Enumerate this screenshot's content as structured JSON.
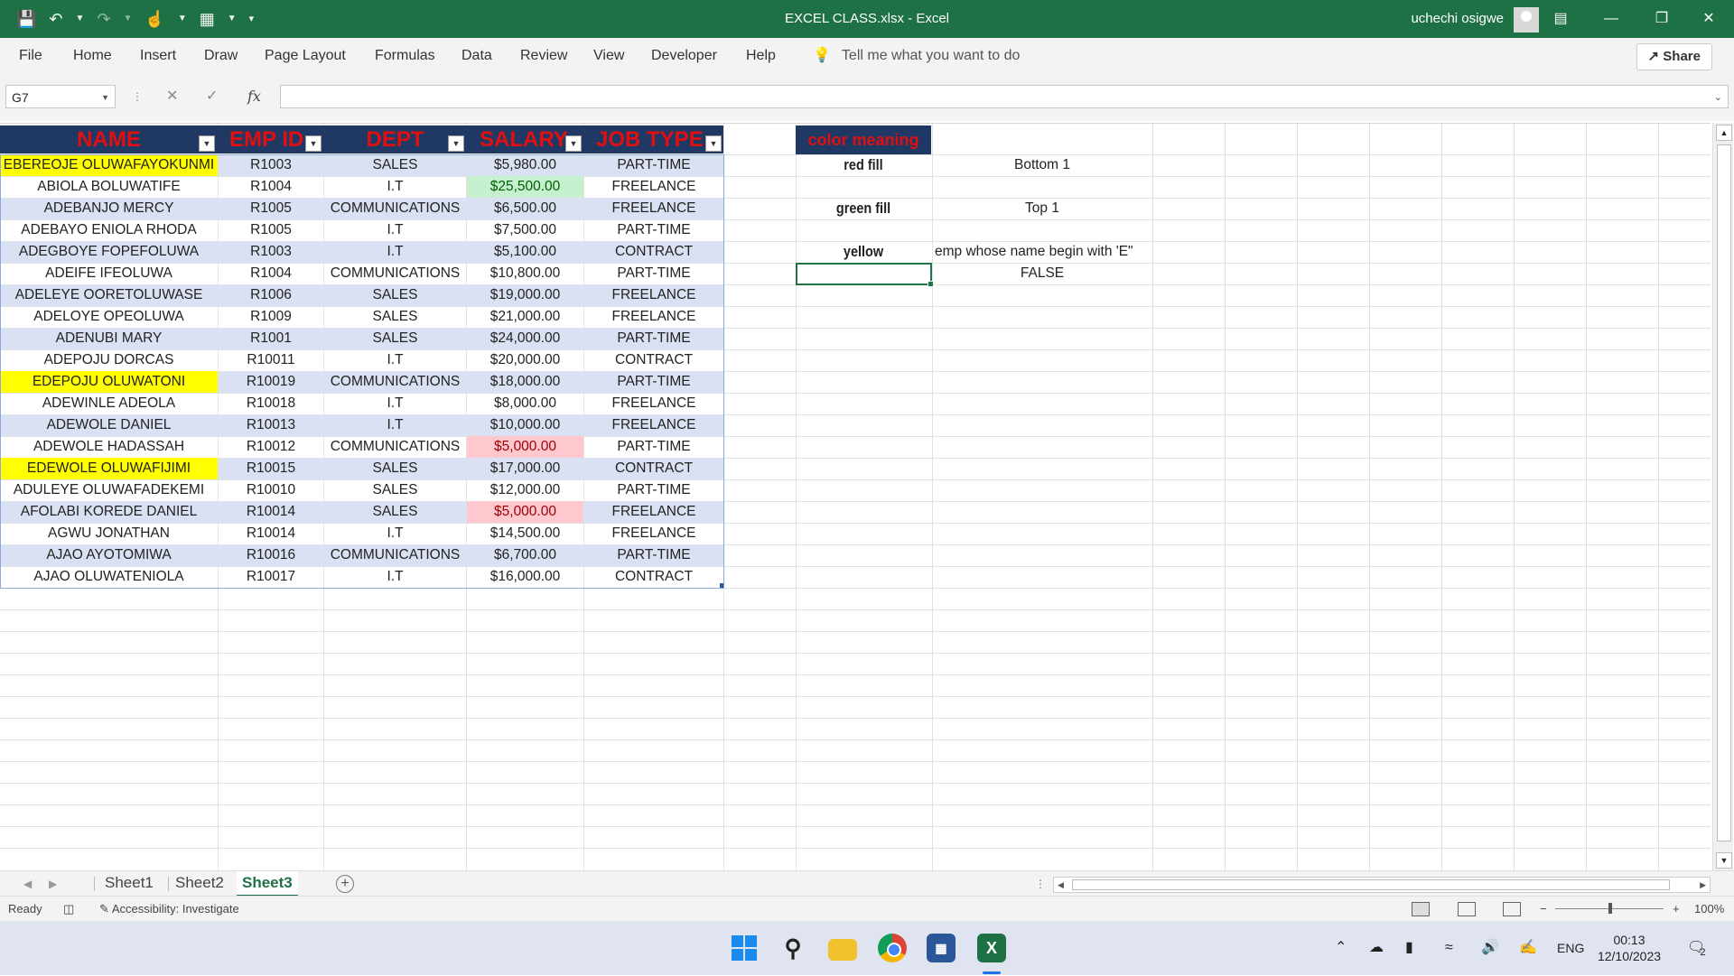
{
  "titlebar": {
    "title": "EXCEL CLASS.xlsx  -  Excel",
    "user": "uchechi osigwe",
    "qat": [
      "save-icon",
      "undo-icon",
      "redo-icon",
      "touch-mode-icon",
      "form-icon",
      "customize-qat-icon"
    ]
  },
  "ribbon": {
    "tabs": [
      "File",
      "Home",
      "Insert",
      "Draw",
      "Page Layout",
      "Formulas",
      "Data",
      "Review",
      "View",
      "Developer",
      "Help"
    ],
    "tell_me": "Tell me what you want to do",
    "share": "Share"
  },
  "formula_bar": {
    "name_box": "G7",
    "cancel": "✕",
    "enter": "✓",
    "fx": "fx",
    "value": ""
  },
  "table": {
    "headers": [
      "NAME",
      "EMP ID",
      "DEPT",
      "SALARY",
      "JOB TYPE"
    ],
    "rows": [
      {
        "name": "EBEREOJE OLUWAFAYOKUNMI",
        "id": "R1003",
        "dept": "SALES",
        "salary": "$5,980.00",
        "job": "PART-TIME",
        "name_fill": "yellow"
      },
      {
        "name": "ABIOLA BOLUWATIFE",
        "id": "R1004",
        "dept": "I.T",
        "salary": "$25,500.00",
        "job": "FREELANCE",
        "salary_fill": "green"
      },
      {
        "name": "ADEBANJO MERCY",
        "id": "R1005",
        "dept": "COMMUNICATIONS",
        "salary": "$6,500.00",
        "job": "FREELANCE"
      },
      {
        "name": "ADEBAYO ENIOLA RHODA",
        "id": "R1005",
        "dept": "I.T",
        "salary": "$7,500.00",
        "job": "PART-TIME"
      },
      {
        "name": "ADEGBOYE FOPEFOLUWA",
        "id": "R1003",
        "dept": "I.T",
        "salary": "$5,100.00",
        "job": "CONTRACT"
      },
      {
        "name": "ADEIFE IFEOLUWA",
        "id": "R1004",
        "dept": "COMMUNICATIONS",
        "salary": "$10,800.00",
        "job": "PART-TIME"
      },
      {
        "name": "ADELEYE OORETOLUWASE",
        "id": "R1006",
        "dept": "SALES",
        "salary": "$19,000.00",
        "job": "FREELANCE"
      },
      {
        "name": "ADELOYE OPEOLUWA",
        "id": "R1009",
        "dept": "SALES",
        "salary": "$21,000.00",
        "job": "FREELANCE"
      },
      {
        "name": "ADENUBI MARY",
        "id": "R1001",
        "dept": "SALES",
        "salary": "$24,000.00",
        "job": "PART-TIME"
      },
      {
        "name": "ADEPOJU DORCAS",
        "id": "R10011",
        "dept": "I.T",
        "salary": "$20,000.00",
        "job": "CONTRACT"
      },
      {
        "name": "EDEPOJU OLUWATONI",
        "id": "R10019",
        "dept": "COMMUNICATIONS",
        "salary": "$18,000.00",
        "job": "PART-TIME",
        "name_fill": "yellow"
      },
      {
        "name": "ADEWINLE ADEOLA",
        "id": "R10018",
        "dept": "I.T",
        "salary": "$8,000.00",
        "job": "FREELANCE"
      },
      {
        "name": "ADEWOLE DANIEL",
        "id": "R10013",
        "dept": "I.T",
        "salary": "$10,000.00",
        "job": "FREELANCE"
      },
      {
        "name": "ADEWOLE HADASSAH",
        "id": "R10012",
        "dept": "COMMUNICATIONS",
        "salary": "$5,000.00",
        "job": "PART-TIME",
        "salary_fill": "red"
      },
      {
        "name": "EDEWOLE OLUWAFIJIMI",
        "id": "R10015",
        "dept": "SALES",
        "salary": "$17,000.00",
        "job": "CONTRACT",
        "name_fill": "yellow"
      },
      {
        "name": "ADULEYE OLUWAFADEKEMI",
        "id": "R10010",
        "dept": "SALES",
        "salary": "$12,000.00",
        "job": "PART-TIME"
      },
      {
        "name": "AFOLABI KOREDE DANIEL",
        "id": "R10014",
        "dept": "SALES",
        "salary": "$5,000.00",
        "job": "FREELANCE",
        "salary_fill": "red"
      },
      {
        "name": "AGWU JONATHAN",
        "id": "R10014",
        "dept": "I.T",
        "salary": "$14,500.00",
        "job": "FREELANCE"
      },
      {
        "name": "AJAO AYOTOMIWA",
        "id": "R10016",
        "dept": "COMMUNICATIONS",
        "salary": "$6,700.00",
        "job": "PART-TIME"
      },
      {
        "name": "AJAO OLUWATENIOLA",
        "id": "R10017",
        "dept": "I.T",
        "salary": "$16,000.00",
        "job": "CONTRACT"
      }
    ]
  },
  "legend": {
    "title": "color meaning",
    "items": [
      {
        "key": "red fill",
        "value": "Bottom 1"
      },
      {
        "key": "green fill",
        "value": "Top 1"
      },
      {
        "key": "yellow",
        "value": "emp whose name begin with 'E\""
      }
    ],
    "result": "FALSE"
  },
  "sheets": {
    "tabs": [
      "Sheet1",
      "Sheet2",
      "Sheet3"
    ],
    "active": "Sheet3"
  },
  "status": {
    "ready": "Ready",
    "accessibility": "Accessibility: Investigate",
    "zoom": "100%"
  },
  "taskbar": {
    "time": "00:13",
    "date": "12/10/2023",
    "lang": "ENG",
    "notifications": "2"
  },
  "colors": {
    "excel_green": "#1e7145",
    "header_navy": "#1f3864",
    "header_text_red": "#e01010",
    "band_blue": "#d9e1f2",
    "fill_yellow": "#ffff00",
    "fill_green": "#c6efce",
    "fill_green_text": "#006100",
    "fill_red": "#ffc7ce",
    "fill_red_text": "#9c0006"
  }
}
